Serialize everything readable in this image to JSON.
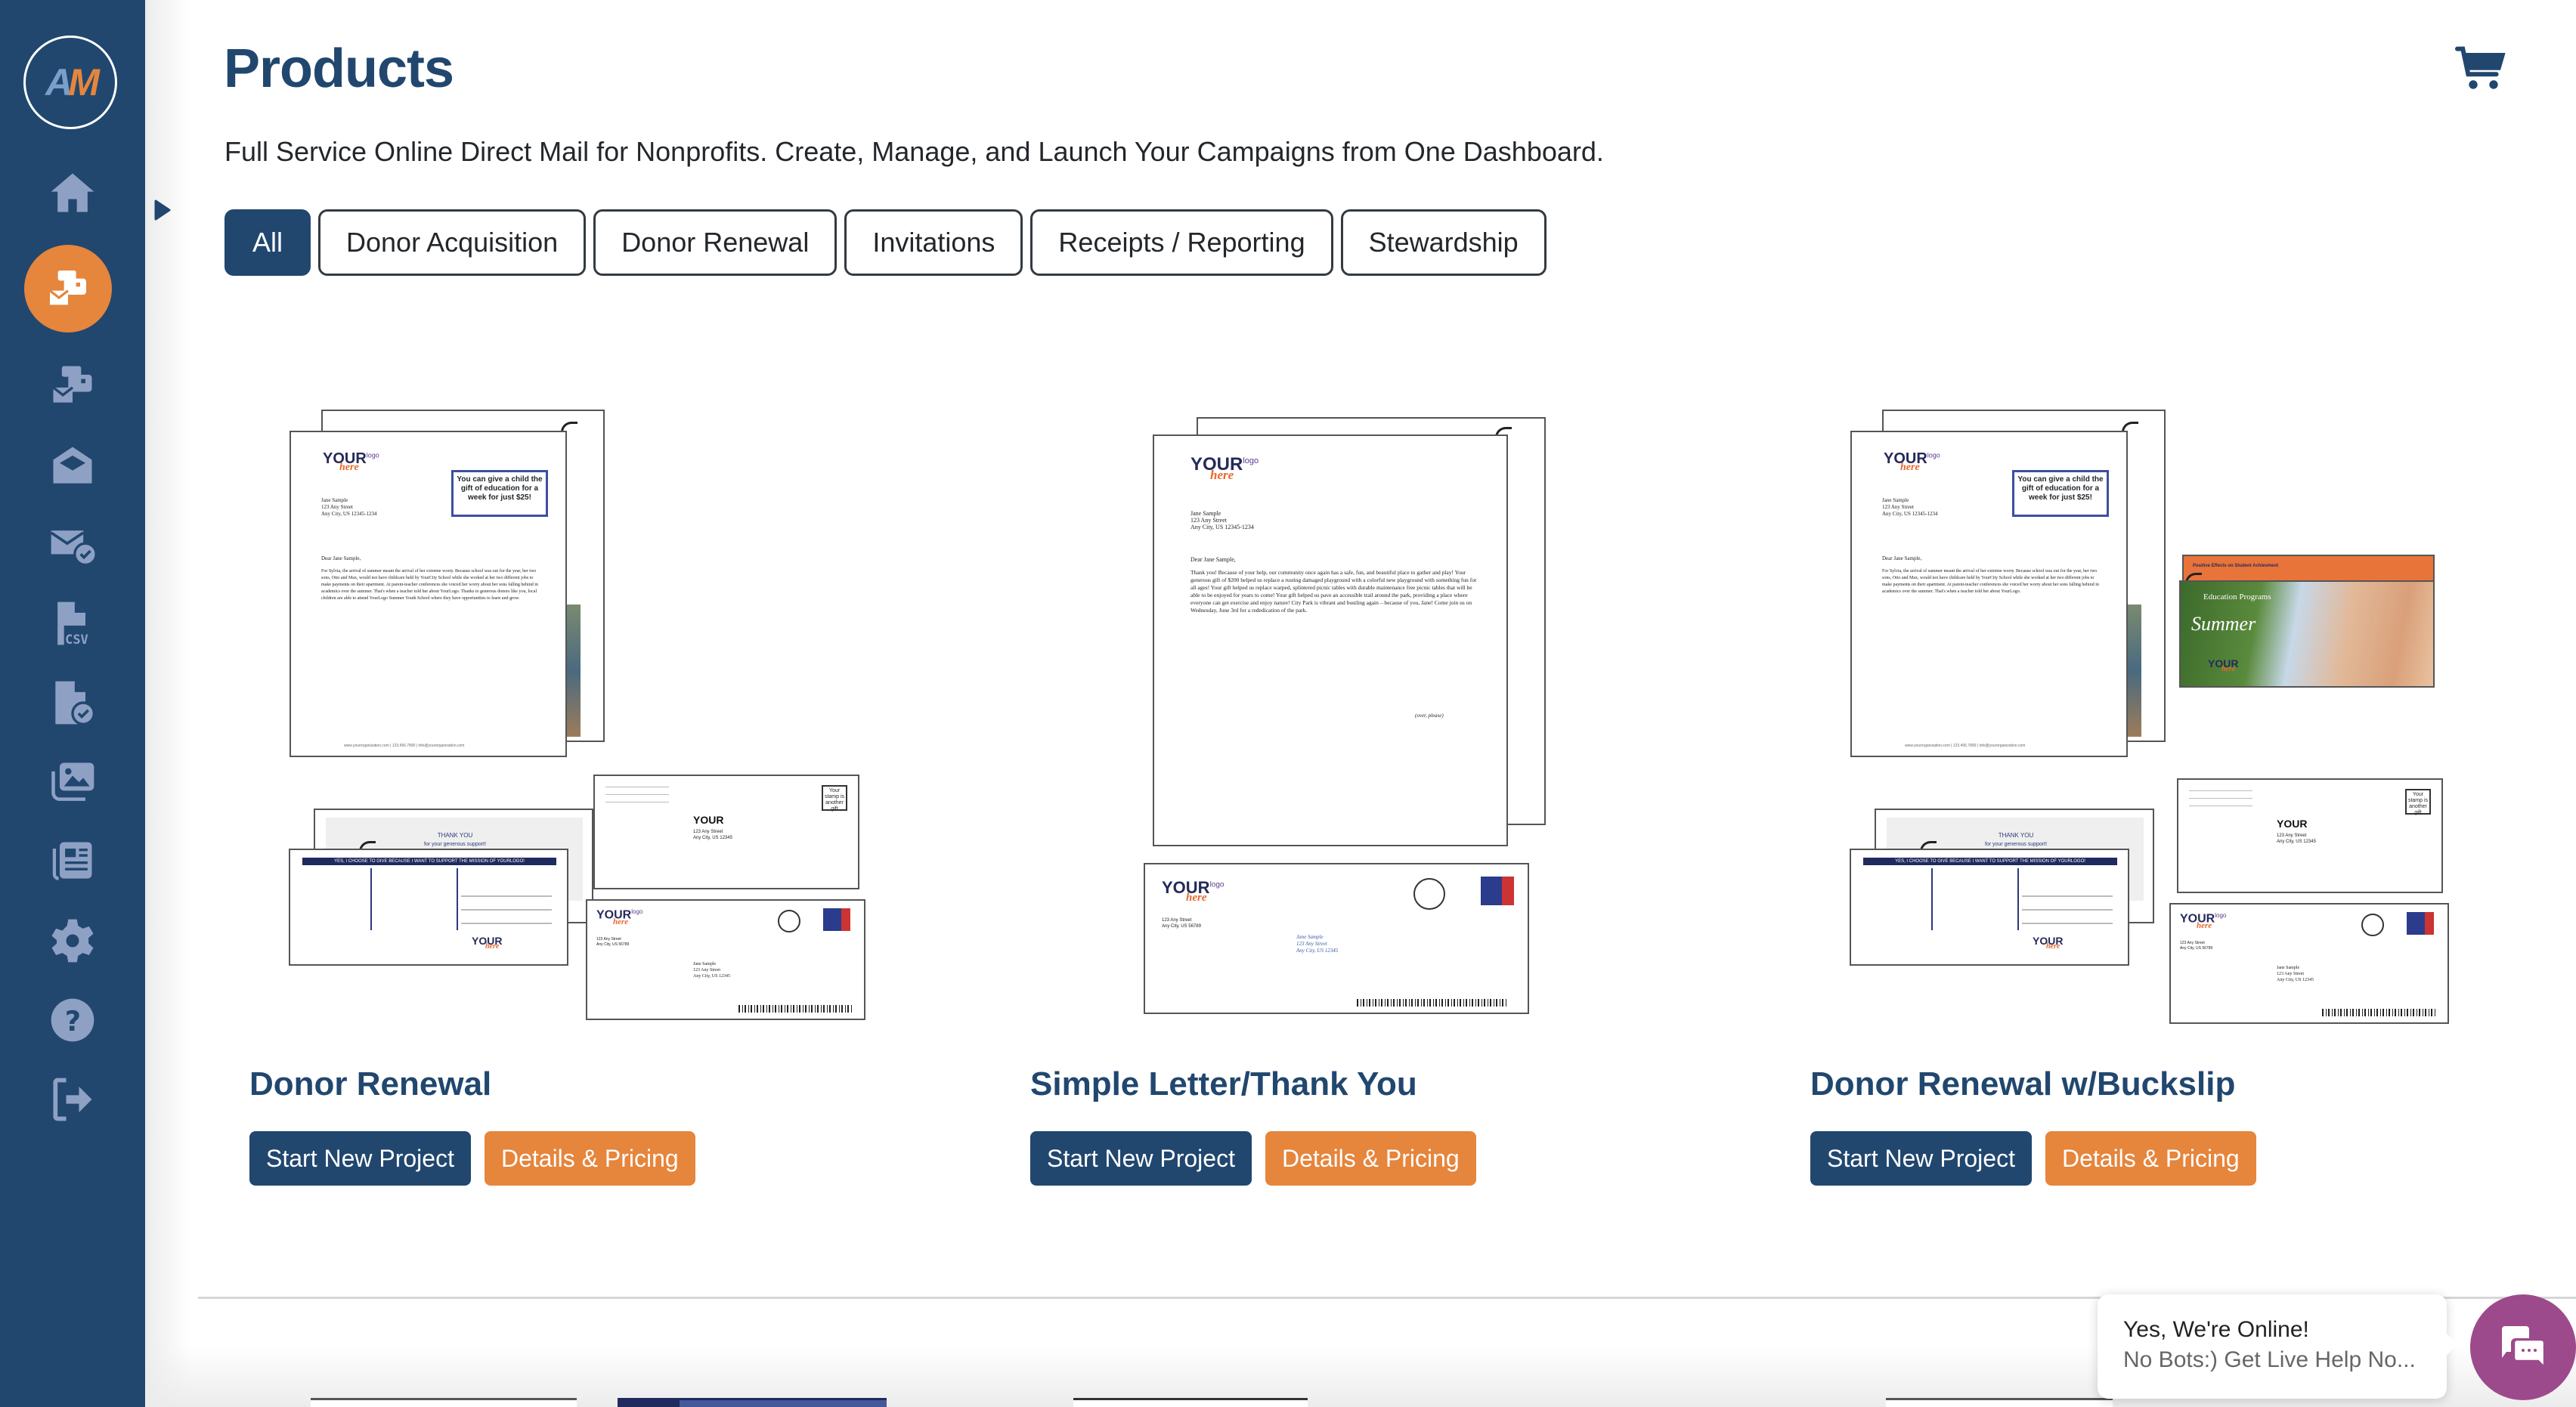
{
  "sidebar": {
    "logo_text_a": "A",
    "logo_text_m": "M",
    "items": [
      {
        "name": "home",
        "icon": "home-icon",
        "active": false
      },
      {
        "name": "products",
        "icon": "mail-bulk-icon",
        "active": true
      },
      {
        "name": "campaigns",
        "icon": "mail-bulk-icon",
        "active": false
      },
      {
        "name": "open-mail",
        "icon": "envelope-open-icon",
        "active": false
      },
      {
        "name": "approved-mail",
        "icon": "envelope-check-icon",
        "active": false
      },
      {
        "name": "csv-lists",
        "icon": "file-csv-icon",
        "active": false
      },
      {
        "name": "proofs",
        "icon": "file-check-icon",
        "active": false
      },
      {
        "name": "images",
        "icon": "images-icon",
        "active": false
      },
      {
        "name": "news",
        "icon": "newspaper-icon",
        "active": false
      },
      {
        "name": "settings",
        "icon": "gear-icon",
        "active": false
      },
      {
        "name": "help",
        "icon": "question-circle-icon",
        "active": false
      },
      {
        "name": "logout",
        "icon": "sign-out-icon",
        "active": false
      }
    ]
  },
  "header": {
    "title": "Products",
    "description": "Full Service Online Direct Mail for Nonprofits. Create, Manage, and Launch Your Campaigns from One Dashboard.",
    "cart_icon": "shopping-cart-icon"
  },
  "filters": [
    {
      "label": "All",
      "active": true
    },
    {
      "label": "Donor Acquisition",
      "active": false
    },
    {
      "label": "Donor Renewal",
      "active": false
    },
    {
      "label": "Invitations",
      "active": false
    },
    {
      "label": "Receipts / Reporting",
      "active": false
    },
    {
      "label": "Stewardship",
      "active": false
    }
  ],
  "products": [
    {
      "title": "Donor Renewal",
      "start_label": "Start New Project",
      "details_label": "Details & Pricing",
      "mock": {
        "logo_your": "YOUR",
        "logo_sup": "logo",
        "logo_here": "here",
        "address": "Jane Sample\n123 Any Street\nAny City, US 12345-1234",
        "callout": "You can give a child the gift of education for a week for just $25!",
        "salutation": "Dear Jane Sample,",
        "body": "For Sylvia, the arrival of summer meant the arrival of her extreme worry. Because school was out for the year, her two sons, Otto and Max, would not have childcare held by YourCity School while she worked at her two different jobs to make payments on their apartment. At parent-teacher conferences she voiced her worry about her sons falling behind in academics over the summer. That's when a teacher told her about YourLogo. Thanks to generous donors like you, local children are able to attend YourLogo Summer Youth School where they have opportunities to learn and grow.",
        "footer": "www.yourorganization.com | 123.456.7890 | info@yourorganization.com",
        "reply_band": "YES, I CHOOSE TO GIVE BECAUSE I WANT TO SUPPORT THE MISSION OF YOURLOGO!",
        "thank_you": "THANK YOU",
        "thank_you_sub": "for your generous support!",
        "env_address": "123 Any Street\nAny City, US 12345",
        "stamp": "Your stamp is another gift",
        "outer_address": "Jane Sample\n123 Any Street\nAny City, US 12345",
        "return_address": "123 Any Street\nAny City, US 56789"
      }
    },
    {
      "title": "Simple Letter/Thank You",
      "start_label": "Start New Project",
      "details_label": "Details & Pricing",
      "mock": {
        "logo_your": "YOUR",
        "logo_sup": "logo",
        "logo_here": "here",
        "address": "Jane Sample\n123 Any Street\nAny City, US 12345-1234",
        "salutation": "Dear Jane Sample,",
        "body": "Thank you! Because of your help, our community once again has a safe, fun, and beautiful place to gather and play! Your generous gift of $200 helped us replace a rusting damaged playground with a colorful new playground with something fun for all ages! Your gift helped us replace warped, splintered picnic tables with durable maintenance free picnic tables that will be able to be enjoyed for years to come! Your gift helped us pave an accessible trail around the park, providing a place where everyone can get exercise and enjoy nature! City Park is vibrant and bustling again – because of you, Jane! Come join us on Wednesday, June 3rd for a rededication of the park.",
        "over": "(over, please)",
        "return_address": "123 Any Street\nAny City, US 56789",
        "handwritten_address": "Jane Sample\n123 Any Street\nAny City, US 12345"
      }
    },
    {
      "title": "Donor Renewal w/Buckslip",
      "start_label": "Start New Project",
      "details_label": "Details & Pricing",
      "mock": {
        "logo_your": "YOUR",
        "logo_sup": "logo",
        "logo_here": "here",
        "address": "Jane Sample\n123 Any Street\nAny City, US 12345-1234",
        "callout": "You can give a child the gift of education for a week for just $25!",
        "salutation": "Dear Jane Sample,",
        "body": "For Sylvia, the arrival of summer meant the arrival of her extreme worry. Because school was out for the year, her two sons, Otto and Max, would not have childcare held by YourCity School while she worked at her two different jobs to make payments on their apartment. At parent-teacher conferences she voiced her worry about her sons falling behind in academics over the summer. That's when a teacher told her about YourLogo.",
        "footer": "www.yourorganization.com | 123.456.7890 | info@yourorganization.com",
        "buckslip_title": "Education Programs",
        "buckslip_script": "Summer",
        "buckslip_back": "Positive Effects on Student Achievment",
        "reply_band": "YES, I CHOOSE TO GIVE BECAUSE I WANT TO SUPPORT THE MISSION OF YOURLOGO!",
        "thank_you": "THANK YOU",
        "thank_you_sub": "for your generous support!",
        "env_address": "123 Any Street\nAny City, US 12345",
        "stamp": "Your stamp is another gift",
        "outer_address": "Jane Sample\n123 Any Street\nAny City, US 12345",
        "return_address": "123 Any Street\nAny City, US 56789"
      }
    }
  ],
  "chat": {
    "line1": "Yes, We're Online!",
    "line2": "No Bots:) Get Live Help No...",
    "icon": "chat-bubbles-icon"
  },
  "colors": {
    "brand_navy": "#21476f",
    "brand_orange": "#e6853c",
    "sidebar_icon": "#8ea1c4",
    "chat_purple": "#9c4a8c"
  }
}
